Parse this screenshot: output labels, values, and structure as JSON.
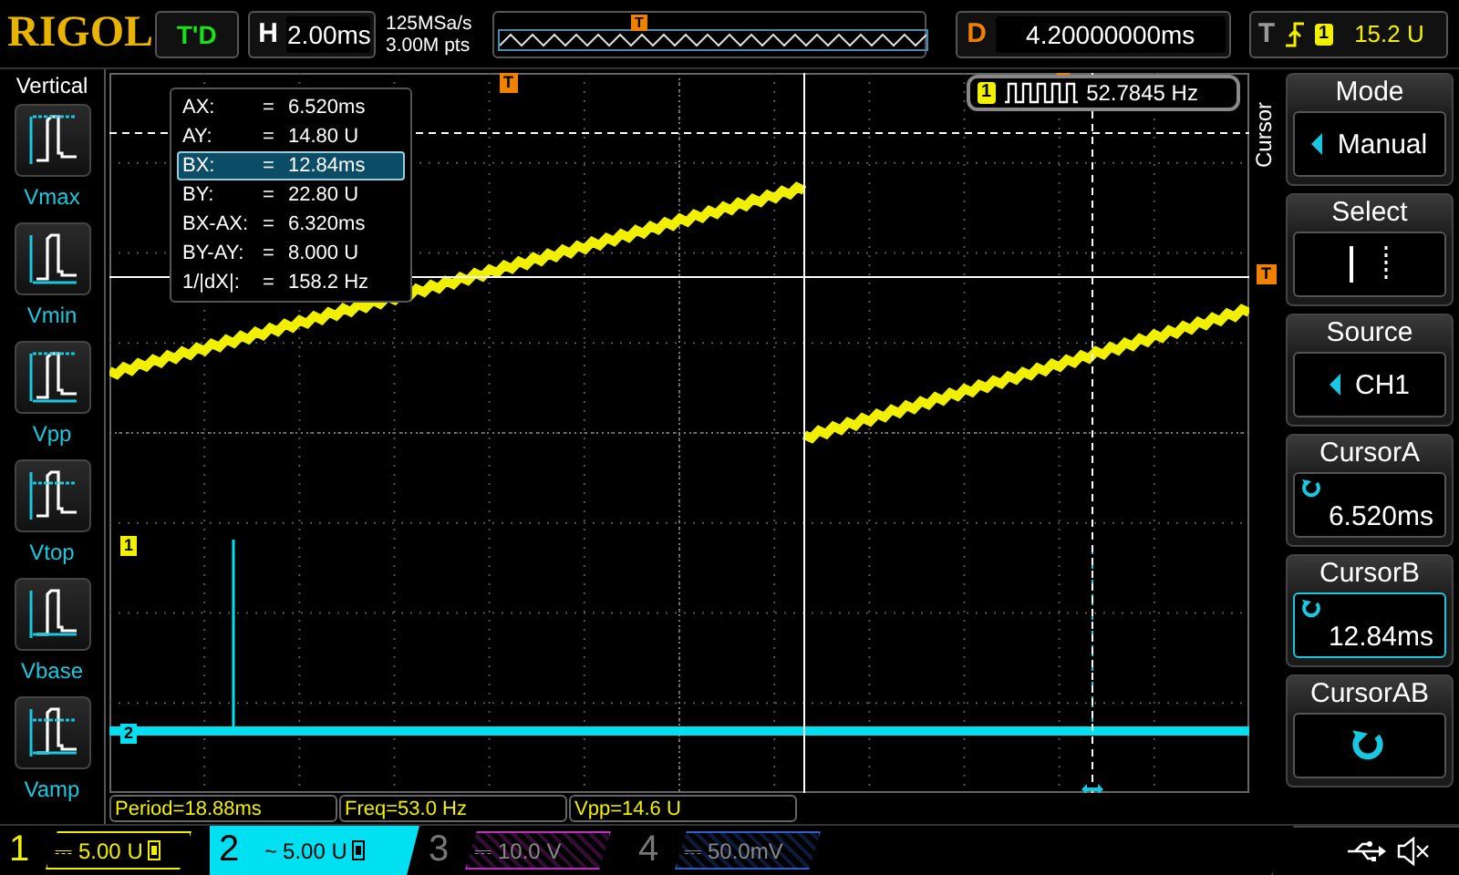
{
  "header": {
    "logo": "RIGOL",
    "run_status": "T'D",
    "timebase": {
      "label": "H",
      "value": "2.00ms"
    },
    "sample_rate": "125MSa/s",
    "memory_depth": "3.00M pts",
    "overview_marker": "T",
    "delay": {
      "label": "D",
      "value": "4.20000000ms"
    },
    "trigger": {
      "label": "T",
      "channel": "1",
      "level": "15.2 U"
    }
  },
  "measure_panel": {
    "title": "Vertical",
    "items": [
      {
        "label": "Vmax",
        "kind": "max"
      },
      {
        "label": "Vmin",
        "kind": "min"
      },
      {
        "label": "Vpp",
        "kind": "pp"
      },
      {
        "label": "Vtop",
        "kind": "top"
      },
      {
        "label": "Vbase",
        "kind": "base"
      },
      {
        "label": "Vamp",
        "kind": "amp"
      }
    ]
  },
  "plot": {
    "trigger_position_marker": "T",
    "trigger_level_marker": "T",
    "channel_markers": [
      {
        "label": "1",
        "color": "#f0f000"
      },
      {
        "label": "2",
        "color": "#00e0f0"
      }
    ]
  },
  "cursor_readout": {
    "rows": [
      {
        "label": "AX:",
        "eq": "=",
        "value": "6.520ms",
        "selected": false
      },
      {
        "label": "AY:",
        "eq": "=",
        "value": "14.80 U",
        "selected": false
      },
      {
        "label": "BX:",
        "eq": "=",
        "value": "12.84ms",
        "selected": true
      },
      {
        "label": "BY:",
        "eq": "=",
        "value": "22.80 U",
        "selected": false
      },
      {
        "label": "BX-AX:",
        "eq": "=",
        "value": "6.320ms",
        "selected": false
      },
      {
        "label": "BY-AY:",
        "eq": "=",
        "value": "8.000 U",
        "selected": false
      },
      {
        "label": "1/|dX|:",
        "eq": "=",
        "value": "158.2 Hz",
        "selected": false
      }
    ]
  },
  "frequency_counter": {
    "channel": "1",
    "value": "52.7845 Hz"
  },
  "measurements": [
    {
      "text": "Period=18.88ms"
    },
    {
      "text": "Freq=53.0 Hz"
    },
    {
      "text": "Vpp=14.6 U"
    }
  ],
  "side_menu": {
    "title": "Cursor",
    "items": [
      {
        "label": "Mode",
        "kind": "select",
        "value": "Manual",
        "selected": false
      },
      {
        "label": "Select",
        "kind": "cursor-select",
        "selected": false
      },
      {
        "label": "Source",
        "kind": "select",
        "value": "CH1",
        "selected": false
      },
      {
        "label": "CursorA",
        "kind": "knob",
        "value": "6.520ms",
        "selected": false
      },
      {
        "label": "CursorB",
        "kind": "knob",
        "value": "12.84ms",
        "selected": true
      },
      {
        "label": "CursorAB",
        "kind": "knob",
        "selected": false
      }
    ]
  },
  "channels": [
    {
      "number": "1",
      "coupling": "⎓",
      "scale": "5.00 U",
      "enabled": true,
      "selected": false,
      "color": "#f0f000"
    },
    {
      "number": "2",
      "coupling": "~",
      "scale": "5.00 U",
      "enabled": true,
      "selected": true,
      "color": "#00e0f0"
    },
    {
      "number": "3",
      "coupling": "⎓",
      "scale": "10.0 V",
      "enabled": false,
      "selected": false,
      "color": "#c030c0"
    },
    {
      "number": "4",
      "coupling": "⎓",
      "scale": "50.0mV",
      "enabled": false,
      "selected": false,
      "color": "#3060d0"
    }
  ]
}
